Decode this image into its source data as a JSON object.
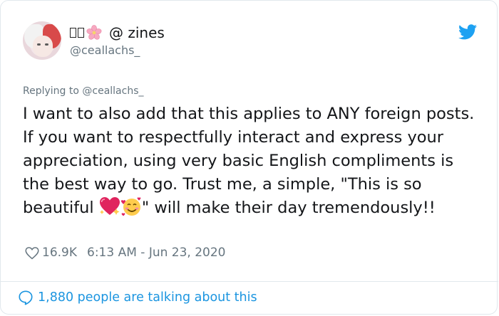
{
  "author": {
    "display_name": "@ zines",
    "handle": "@ceallachs_",
    "name_prefix_glyphs": "□□",
    "flower_icon": "cherry-blossom-icon",
    "avatar_colors": {
      "hair_left": "#f2f2f2",
      "hair_right": "#d84a4a"
    }
  },
  "platform_icon": "twitter-bird-icon",
  "reply": {
    "prefix": "Replying to ",
    "to_handle": "@ceallachs_"
  },
  "tweet": {
    "text_before_emoji": "I want to also add that this applies to ANY foreign posts. If you want to respectfully interact and express your appreciation, using very basic English compliments is the best way to go. Trust me, a simple, \"This is so beautiful ",
    "emojis": [
      "sparkling-heart-emoji",
      "smiling-face-with-hearts-emoji"
    ],
    "text_after_emoji": "\" will make their day tremendously!!"
  },
  "meta": {
    "likes": "16.9K",
    "timestamp": "6:13 AM - Jun 23, 2020"
  },
  "footer": {
    "talking_text": "1,880 people are talking about this"
  },
  "colors": {
    "link_blue": "#1b95e0",
    "muted_gray": "#66757f",
    "twitter_blue": "#1da1f2",
    "border": "#e1e8ed"
  }
}
